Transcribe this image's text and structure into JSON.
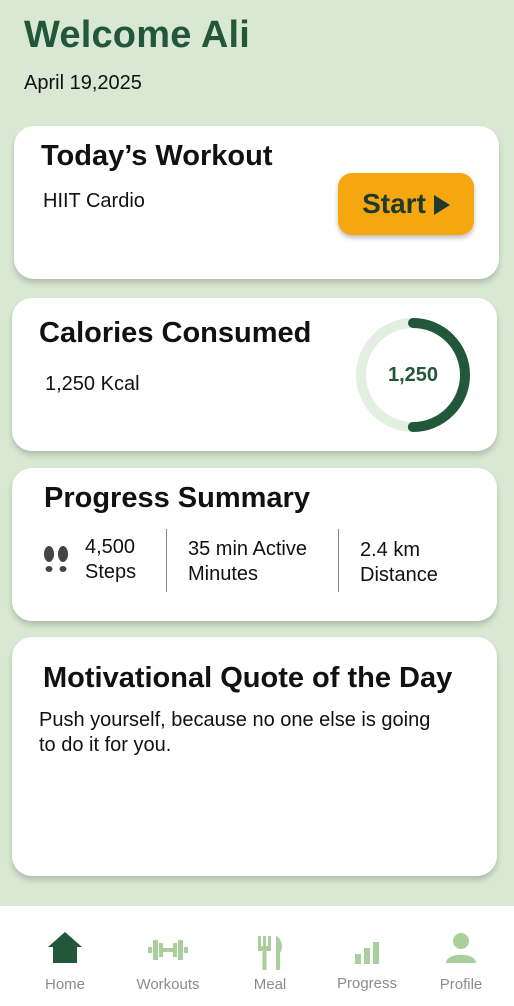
{
  "header": {
    "welcome": "Welcome Ali",
    "date": "April 19,2025"
  },
  "workout": {
    "title": "Today’s Workout",
    "type": "HIIT Cardio",
    "start_label": "Start",
    "start_icon": "play-icon",
    "accent_color": "#f6a60f"
  },
  "calories": {
    "title": "Calories Consumed",
    "value_text": "1,250 Kcal",
    "ring_label": "1,250",
    "ring_progress": 0.5,
    "ring_color": "#22573a",
    "ring_track_color": "#e3efe0"
  },
  "progress": {
    "title": "Progress Summary",
    "steps_icon": "footprints-icon",
    "steps_value": "4,500",
    "steps_label": "Steps",
    "active_value": "35 min Active",
    "active_label": "Minutes",
    "distance_value": "2.4 km",
    "distance_label": "Distance"
  },
  "quote": {
    "title": "Motivational Quote of the Day",
    "text_line1": "Push yourself, because no one else is going",
    "text_line2": "to do it for you."
  },
  "nav": {
    "items": [
      {
        "label": "Home",
        "icon": "home-icon",
        "active": true
      },
      {
        "label": "Workouts",
        "icon": "dumbbell-icon",
        "active": false
      },
      {
        "label": "Meal",
        "icon": "utensils-icon",
        "active": false
      },
      {
        "label": "Progress",
        "icon": "bar-chart-icon",
        "active": false
      },
      {
        "label": "Profile",
        "icon": "user-icon",
        "active": false
      }
    ],
    "active_color": "#22573a",
    "inactive_color": "#a9cf9d"
  }
}
